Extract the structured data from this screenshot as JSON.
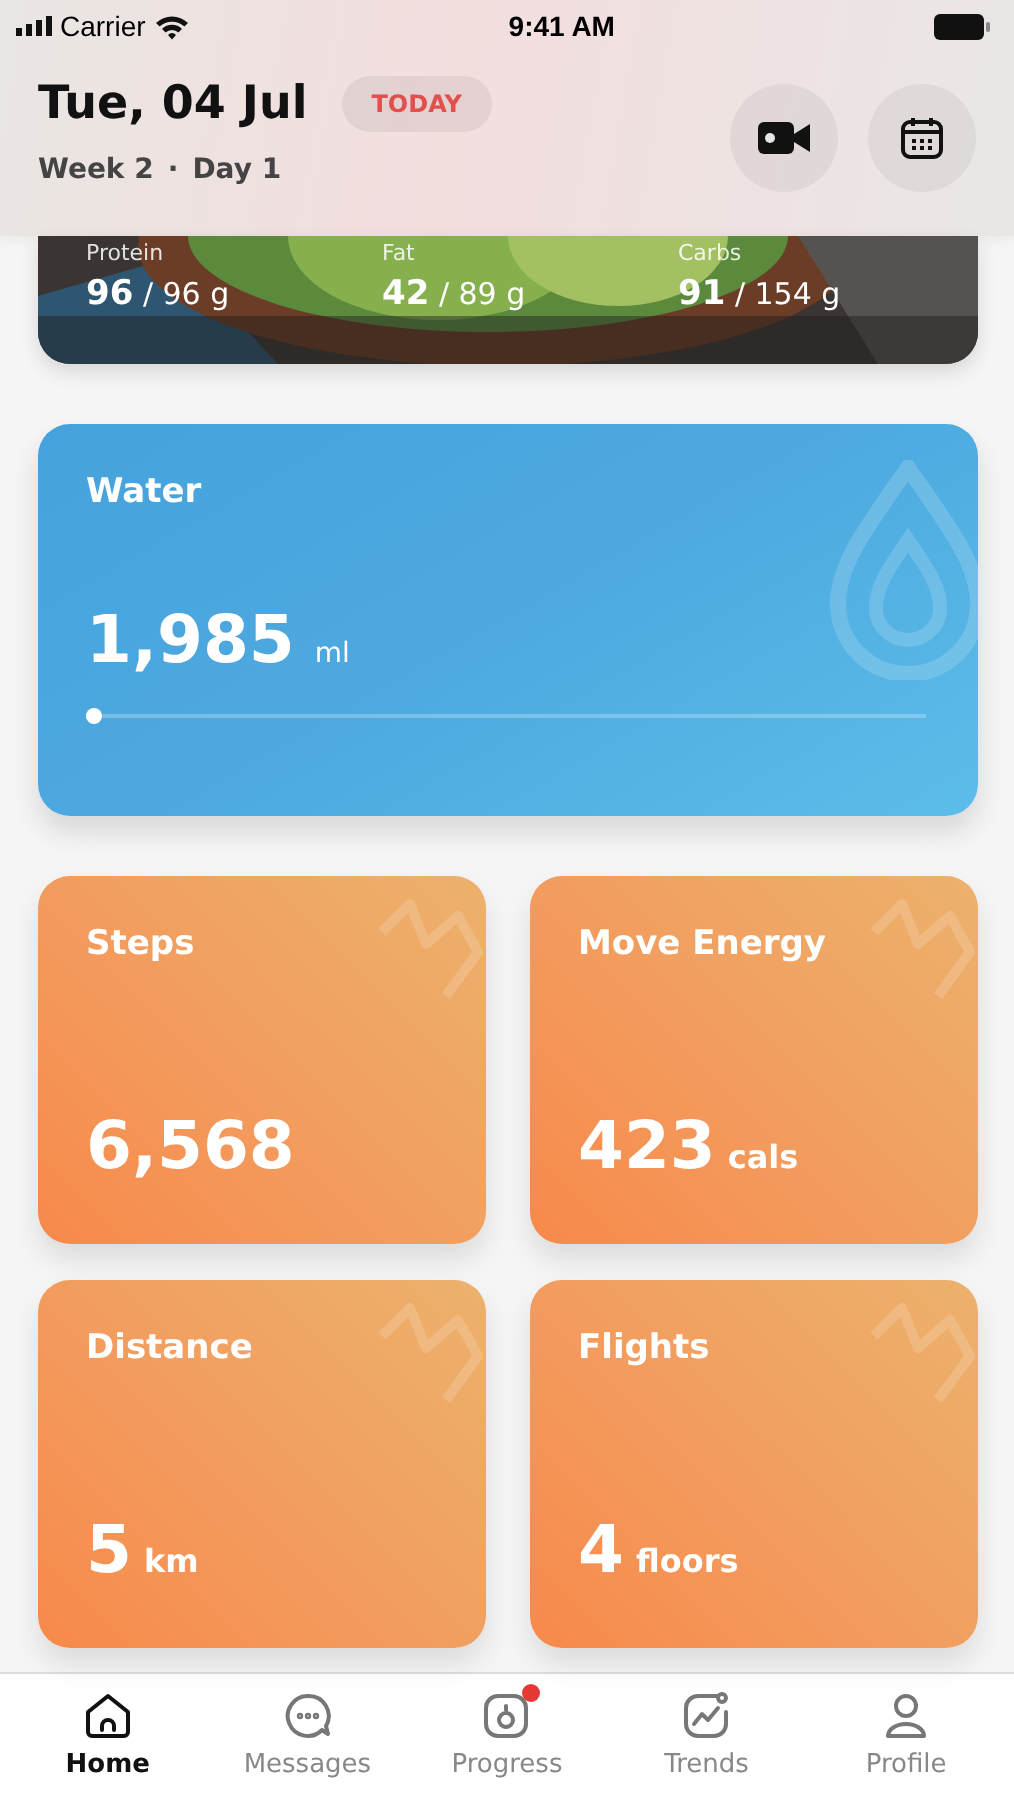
{
  "status_bar": {
    "carrier": "Carrier",
    "time": "9:41 AM"
  },
  "header": {
    "date": "Tue, 04 Jul",
    "badge": "TODAY",
    "week": "Week 2",
    "separator": "·",
    "day": "Day 1"
  },
  "macros": [
    {
      "label": "Protein",
      "value": "96",
      "goal": "/ 96 g"
    },
    {
      "label": "Fat",
      "value": "42",
      "goal": "/ 89 g"
    },
    {
      "label": "Carbs",
      "value": "91",
      "goal": "/ 154 g"
    }
  ],
  "water": {
    "label": "Water",
    "value": "1,985",
    "unit": "ml",
    "level": 0.01
  },
  "metrics": [
    {
      "label": "Steps",
      "value": "6,568"
    },
    {
      "label": "Move Energy",
      "value": "423",
      "unit": "cals"
    },
    {
      "label": "Distance",
      "value": "5",
      "unit": "km"
    },
    {
      "label": "Flights",
      "value": "4",
      "unit": "floors"
    }
  ],
  "tabs": [
    {
      "label": "Home",
      "selected": true,
      "badge": false
    },
    {
      "label": "Messages",
      "selected": false,
      "badge": false
    },
    {
      "label": "Progress",
      "selected": false,
      "badge": true
    },
    {
      "label": "Trends",
      "selected": false,
      "badge": false
    },
    {
      "label": "Profile",
      "selected": false,
      "badge": false
    }
  ]
}
